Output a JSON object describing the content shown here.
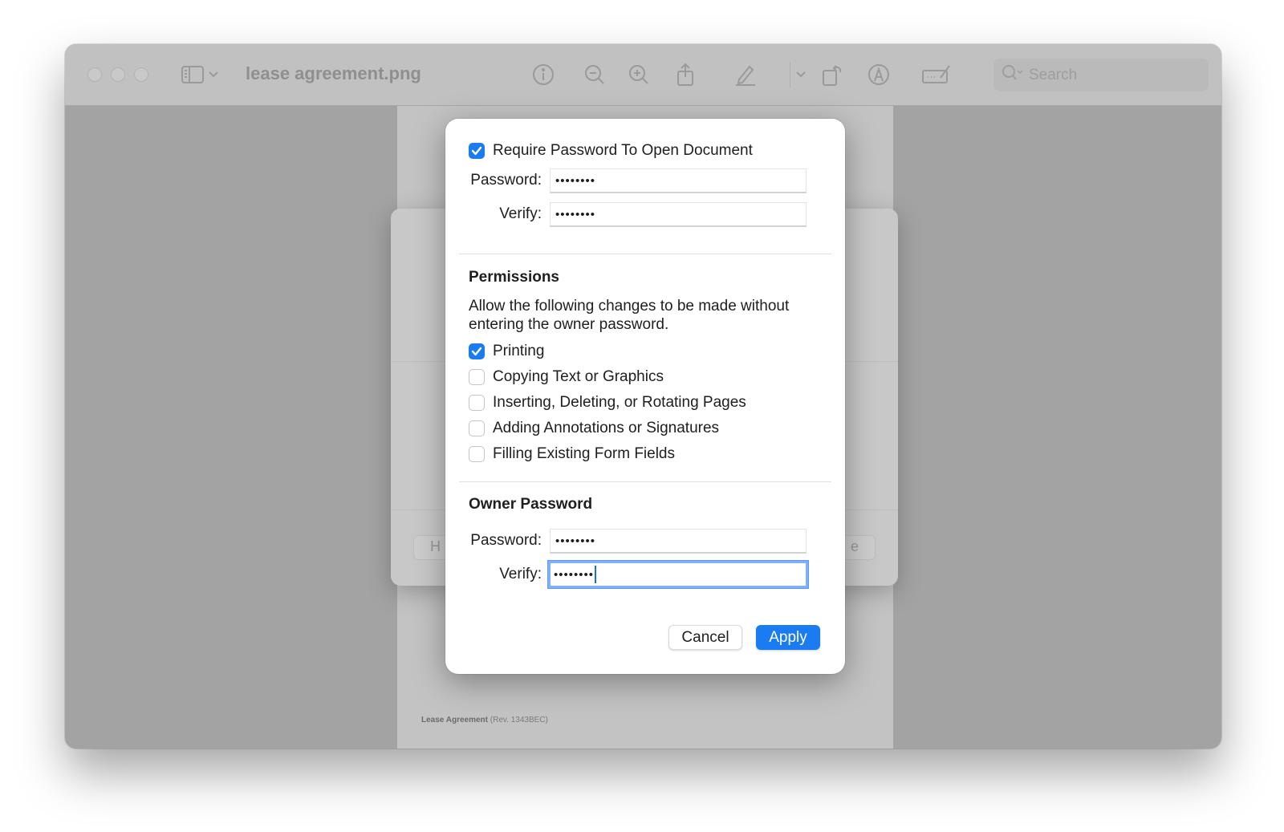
{
  "window": {
    "title": "lease agreement.png",
    "search_placeholder": "Search",
    "toolbar_icons": [
      "sidebar-toggle-icon",
      "chevron-down-icon",
      "info-icon",
      "zoom-out-icon",
      "zoom-in-icon",
      "share-icon",
      "markup-pen-icon",
      "chevron-down-icon",
      "rotate-icon",
      "highlight-circle-icon",
      "signature-icon",
      "search-icon"
    ]
  },
  "document": {
    "footer_title": "Lease Agreement",
    "footer_rev": "(Rev. 1343BEC)"
  },
  "background_sheet": {
    "left_button_partial": "H",
    "right_button_partial": "e"
  },
  "dialog": {
    "require_password": {
      "label": "Require Password To Open Document",
      "checked": true,
      "password_label": "Password:",
      "password_value": "••••••••",
      "verify_label": "Verify:",
      "verify_value": "••••••••"
    },
    "permissions": {
      "heading": "Permissions",
      "description": "Allow the following changes to be made without entering the owner password.",
      "items": [
        {
          "label": "Printing",
          "checked": true
        },
        {
          "label": "Copying Text or Graphics",
          "checked": false
        },
        {
          "label": "Inserting, Deleting, or Rotating Pages",
          "checked": false
        },
        {
          "label": "Adding Annotations or Signatures",
          "checked": false
        },
        {
          "label": "Filling Existing Form Fields",
          "checked": false
        }
      ]
    },
    "owner_password": {
      "heading": "Owner Password",
      "password_label": "Password:",
      "password_value": "••••••••",
      "verify_label": "Verify:",
      "verify_value": "••••••••"
    },
    "buttons": {
      "cancel": "Cancel",
      "apply": "Apply"
    },
    "accent_color": "#1b7bf0"
  }
}
